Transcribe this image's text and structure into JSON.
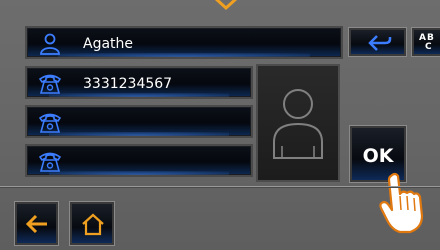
{
  "contact": {
    "name": "Agathe",
    "phones": [
      "3331234567",
      "",
      ""
    ]
  },
  "buttons": {
    "ok_label": "OK",
    "keyboard_letters": [
      "A",
      "B",
      "C"
    ]
  },
  "icons": {
    "name_field": "person-icon",
    "phone_fields": "telephone-icon",
    "photo": "avatar-placeholder-icon",
    "backspace": "backspace-arrow-icon",
    "keyboard": "abc-keyboard-icon",
    "back": "back-arrow-icon",
    "home": "home-icon",
    "pointer": "hand-pointer-icon"
  },
  "colors": {
    "accent_orange": "#f0a020",
    "icon_blue": "#3c7dff",
    "field_bg": "#05080e",
    "panel_bg": "#6a6a6a"
  }
}
